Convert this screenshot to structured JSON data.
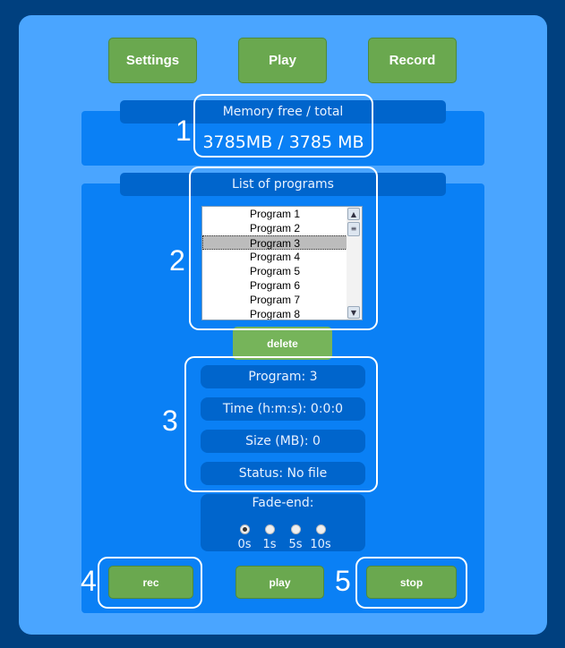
{
  "toolbar": {
    "settings": "Settings",
    "play": "Play",
    "record": "Record"
  },
  "memory": {
    "header": "Memory free / total",
    "value": "3785MB / 3785 MB"
  },
  "programs": {
    "header": "List of programs",
    "items": [
      "Program 1",
      "Program 2",
      "Program 3",
      "Program 4",
      "Program 5",
      "Program 6",
      "Program 7",
      "Program 8"
    ],
    "selected": "Program 3",
    "delete": "delete"
  },
  "info": {
    "program": "Program: 3",
    "time": "Time (h:m:s): 0:0:0",
    "size": "Size (MB): 0",
    "status": "Status: No file"
  },
  "fade": {
    "label": "Fade-end:",
    "options": [
      "0s",
      "1s",
      "5s",
      "10s"
    ],
    "selected": "0s"
  },
  "controls": {
    "rec": "rec",
    "play": "play",
    "stop": "stop"
  },
  "annotations": [
    "1",
    "2",
    "3",
    "4",
    "5"
  ],
  "colors": {
    "background": "#00407f",
    "panel": "#4aa5ff",
    "section": "#0a80f5",
    "header": "#0065cc",
    "button": "#6aa84f"
  }
}
